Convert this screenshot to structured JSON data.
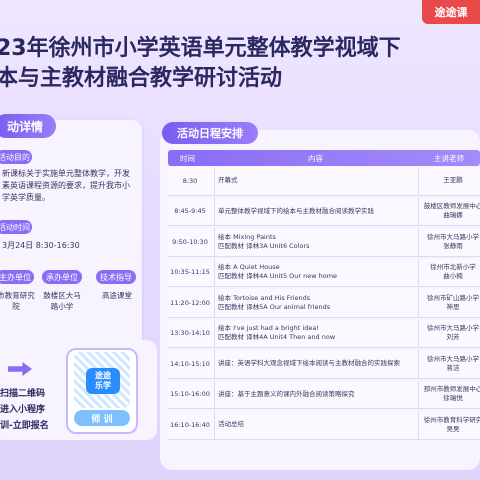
{
  "brand": {
    "label": "途途课"
  },
  "title": {
    "line1": "23年徐州市小学英语单元整体教学视域下",
    "line2": "本与主教材融合教学研讨活动"
  },
  "details": {
    "heading": "动详情",
    "purpose_tag": "活动目的",
    "purpose_text": "新课标关于实施单元整体教学，开发素英语课程资源的要求，提升我市小学英学质量。",
    "time_tag": "活动时间",
    "time_text": "3月24日 8:30-16:30",
    "org_tags": [
      "主办单位",
      "承办单位",
      "技术指导"
    ],
    "org_vals": [
      "市教育研究院",
      "鼓楼区大马路小学",
      "高途课堂"
    ]
  },
  "signup": {
    "steps": [
      "扫描二维码",
      "进入小程序",
      "训-立即报名"
    ],
    "qr_logo_line1": "途途",
    "qr_logo_line2": "乐学",
    "qr_badge": "师 训"
  },
  "schedule": {
    "heading": "活动日程安排",
    "columns": [
      "时间",
      "内容",
      "主讲老师"
    ],
    "rows": [
      {
        "time": "8:30",
        "content": [
          "开幕式"
        ],
        "host": [
          "王亚鹏"
        ]
      },
      {
        "time": "8:45-9:45",
        "content": [
          "单元整体教学视域下的绘本与主教材融合阅读教学实践"
        ],
        "host": [
          "鼓楼区教师发展中心",
          "曲瑞娜"
        ]
      },
      {
        "time": "9:50-10:30",
        "content": [
          "绘本 Mixing Paints",
          "匹配教材 译林3A Unit6 Colors"
        ],
        "host": [
          "徐州市大马路小学",
          "张静雨"
        ]
      },
      {
        "time": "10:35-11:15",
        "content": [
          "绘本 A Quiet House",
          "匹配教材 译林4A Unit5 Our new home"
        ],
        "host": [
          "徐州市北新小学",
          "曲小楠"
        ]
      },
      {
        "time": "11:20-12:00",
        "content": [
          "绘本 Tortoise and His Friends",
          "匹配教材 译林5A Our animal friends"
        ],
        "host": [
          "徐州市矿山路小学",
          "神思"
        ]
      },
      {
        "time": "13:30-14:10",
        "content": [
          "绘本 I've just had a bright idea!",
          "匹配教材 译林4A Unit4 Then and now"
        ],
        "host": [
          "徐州市大马路小学",
          "刘芳"
        ]
      },
      {
        "time": "14:10-15:10",
        "content": [
          "讲座：英语学科大观念视域下绘本阅读与主教材融合的实践探索"
        ],
        "host": [
          "徐州市大马路小学",
          "蒋洁"
        ]
      },
      {
        "time": "15:10-16:00",
        "content": [
          "讲座：基于主题意义的课内外融合阅读策略探究"
        ],
        "host": [
          "邳州市教师发展中心",
          "徐瑞悦"
        ]
      },
      {
        "time": "16:10-16:40",
        "content": [
          "活动总结"
        ],
        "host": [
          "徐州市教育科学研究",
          "吴吴"
        ]
      }
    ]
  }
}
